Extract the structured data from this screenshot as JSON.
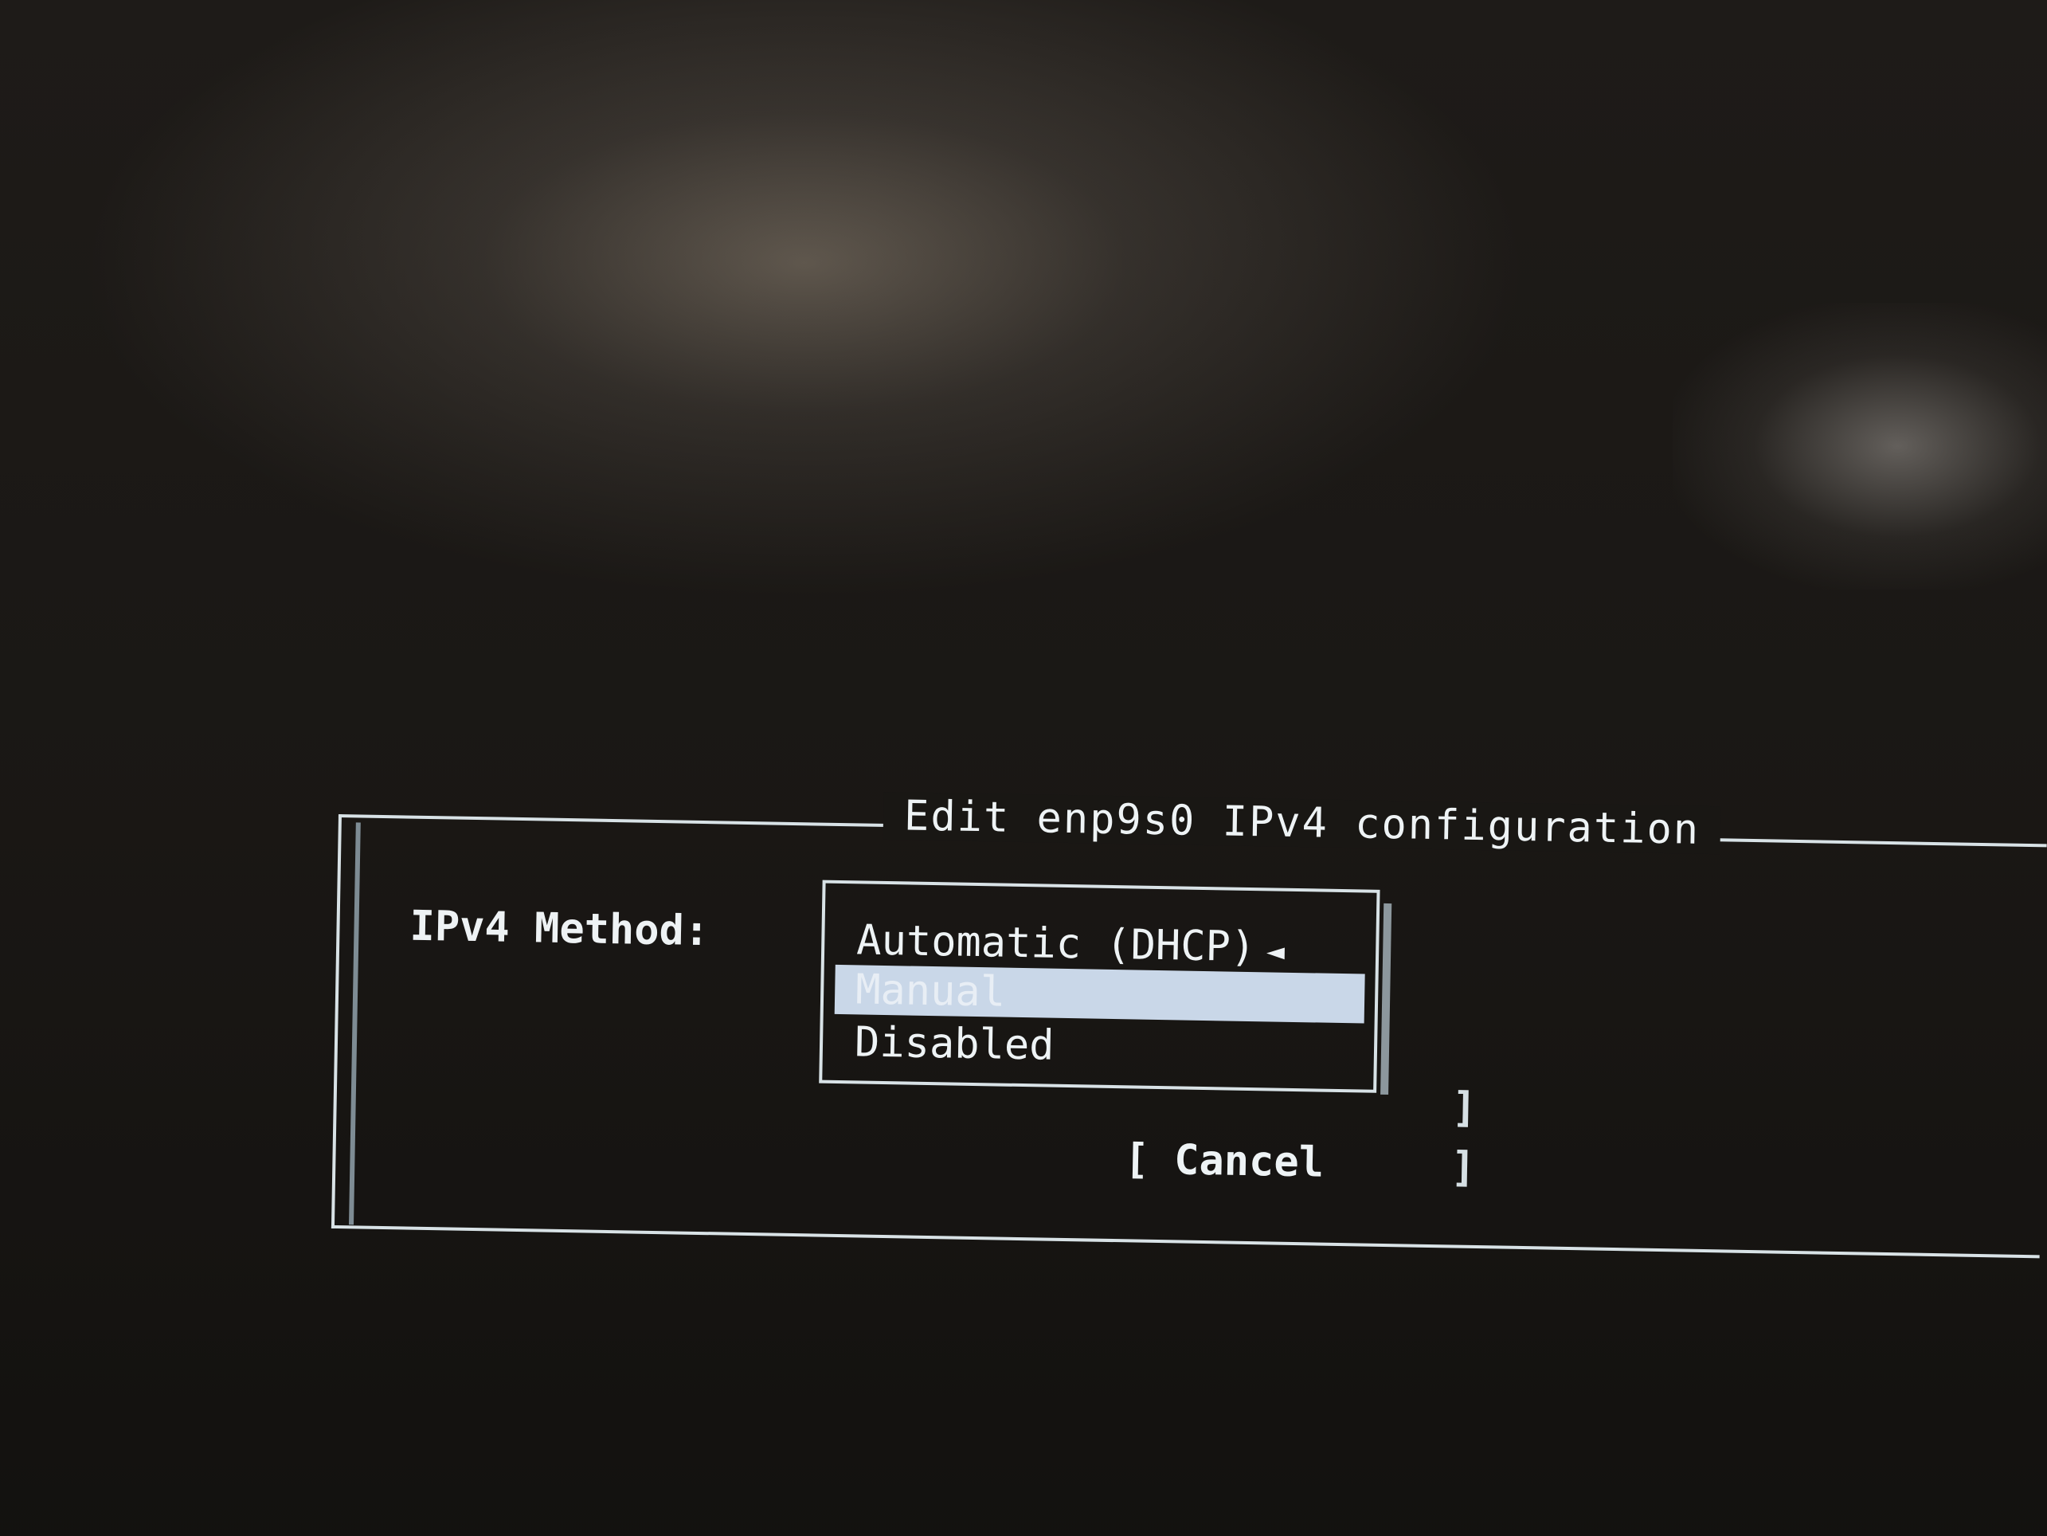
{
  "dialog": {
    "title": "Edit enp9s0 IPv4 configuration",
    "method_label": "IPv4 Method:",
    "selected_marker": "◄",
    "options": [
      {
        "label": "Automatic (DHCP)"
      },
      {
        "label": "Manual"
      },
      {
        "label": "Disabled"
      }
    ],
    "cancel_label": "[ Cancel",
    "bracket_glyph": "]"
  }
}
